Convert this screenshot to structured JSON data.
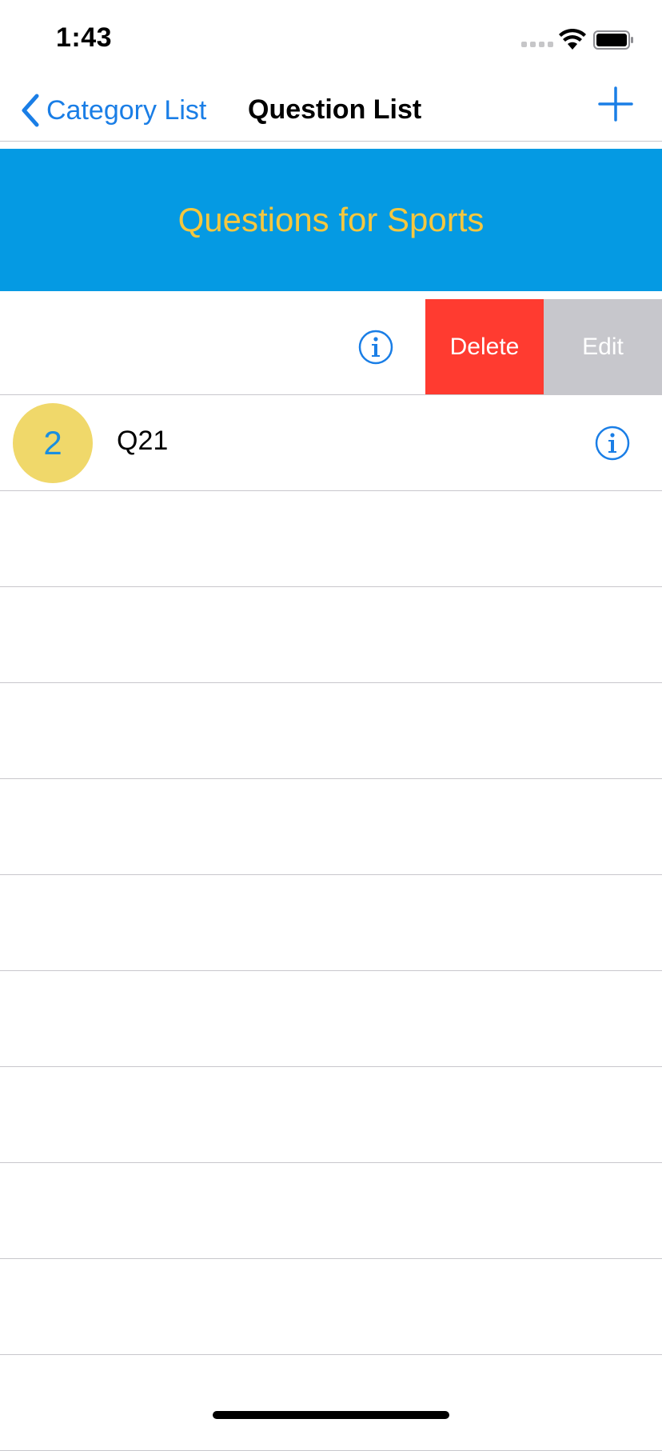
{
  "status_bar": {
    "time": "1:43"
  },
  "nav": {
    "back_label": "Category List",
    "title": "Question List"
  },
  "banner": {
    "title": "Questions for Sports"
  },
  "rows": [
    {
      "swipe_delete": "Delete",
      "swipe_edit": "Edit"
    },
    {
      "badge": "2",
      "label": "Q21"
    }
  ],
  "colors": {
    "accent": "#1a7ee6",
    "banner_bg": "#059ae3",
    "banner_text": "#f5c73f",
    "badge_bg": "#f0d86a",
    "delete_bg": "#ff3b30",
    "edit_bg": "#c7c7cc"
  }
}
